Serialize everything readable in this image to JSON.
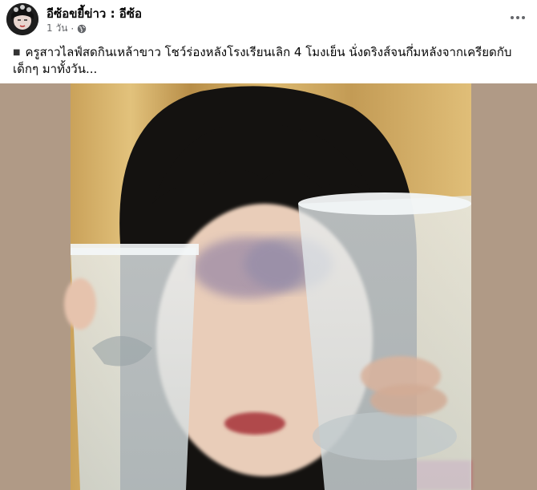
{
  "post": {
    "author": "อีซ้อขยี้ข่าว : อีซ้อ",
    "time": "1 วัน",
    "separator": "·",
    "privacy_icon": "globe-icon",
    "more_icon": "more-horizontal-icon",
    "bullet": "■",
    "text": "ครูสาวไลฟ์สดกินเหล้าขาว โชว์ร่องหลังโรงเรียนเลิก 4 โมงเย็น นั่งดริงส์จนกึ่มหลังจากเครียดกับเด็กๆ มาทั้งวัน..."
  },
  "media": {
    "type": "video-frame",
    "colors": {
      "background": "#b09a86",
      "curtain": "#d4b06a",
      "hair": "#141210"
    }
  }
}
